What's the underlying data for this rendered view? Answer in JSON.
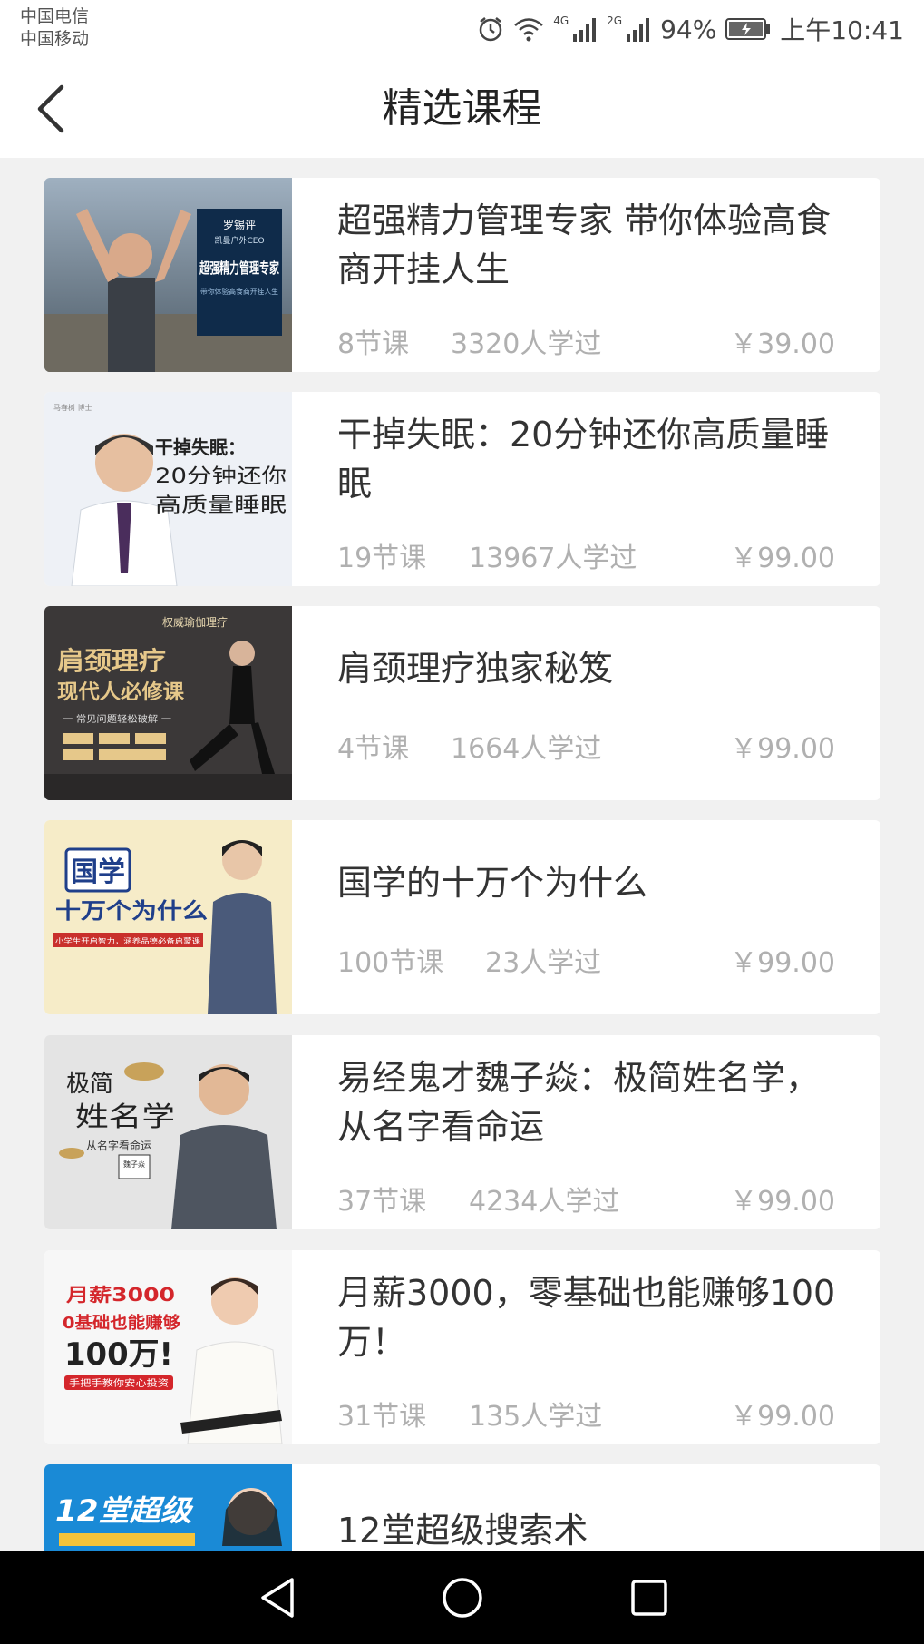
{
  "status_bar": {
    "carrier_1": "中国电信",
    "carrier_2": "中国移动",
    "network_1": "4G",
    "network_2": "2G",
    "battery": "94%",
    "time": "上午10:41"
  },
  "header": {
    "title": "精选课程",
    "back_icon": "chevron-left-icon"
  },
  "courses": [
    {
      "title": "超强精力管理专家 带你体验高食商开挂人生",
      "lessons": "8节课",
      "learners": "3320人学过",
      "price": "￥39.00",
      "thumb": {
        "name": "罗锡评",
        "role": "凯曼户外CEO",
        "headline": "超强精力管理专家",
        "sub": "带你体验高食商开挂人生"
      }
    },
    {
      "title": "干掉失眠：20分钟还你高质量睡眠",
      "lessons": "19节课",
      "learners": "13967人学过",
      "price": "￥99.00",
      "thumb": {
        "caption_1": "干掉失眠：",
        "caption_2": "20分钟还你",
        "caption_3": "高质量睡眠",
        "side_text": "马春树 博士"
      }
    },
    {
      "title": "肩颈理疗独家秘笈",
      "lessons": "4节课",
      "learners": "1664人学过",
      "price": "￥99.00",
      "thumb": {
        "top_text": "权威瑜伽理疗",
        "headline_1": "肩颈理疗",
        "headline_2": "现代人必修课",
        "sub": "一 常见问题轻松破解 一"
      }
    },
    {
      "title": "国学的十万个为什么",
      "lessons": "100节课",
      "learners": "23人学过",
      "price": "￥99.00",
      "thumb": {
        "headline_1": "国学",
        "headline_2": "十万个为什么",
        "sub": "小学生开启智力，涵养品德必备启蒙课"
      }
    },
    {
      "title": "易经鬼才魏子焱：极简姓名学，从名字看命运",
      "lessons": "37节课",
      "learners": "4234人学过",
      "price": "￥99.00",
      "thumb": {
        "headline_1": "极简",
        "headline_2": "姓名学",
        "sub": "从名字看命运",
        "name": "魏子焱"
      }
    },
    {
      "title": "月薪3000，零基础也能赚够100万！",
      "lessons": "31节课",
      "learners": "135人学过",
      "price": "￥99.00",
      "thumb": {
        "line_1": "月薪3000",
        "line_2": "0基础也能赚够",
        "line_3": "100万!",
        "sub": "手把手教你安心投资"
      }
    },
    {
      "title": "12堂超级搜索术",
      "thumb": {
        "headline": "12堂超级"
      }
    }
  ],
  "nav_bar": {
    "back_icon": "triangle-back-icon",
    "home_icon": "circle-home-icon",
    "recents_icon": "square-recents-icon"
  },
  "colors": {
    "background": "#f1f1f1",
    "card": "#ffffff",
    "title_text": "#333333",
    "meta_text": "#b0b0b0",
    "navbar": "#000000"
  }
}
